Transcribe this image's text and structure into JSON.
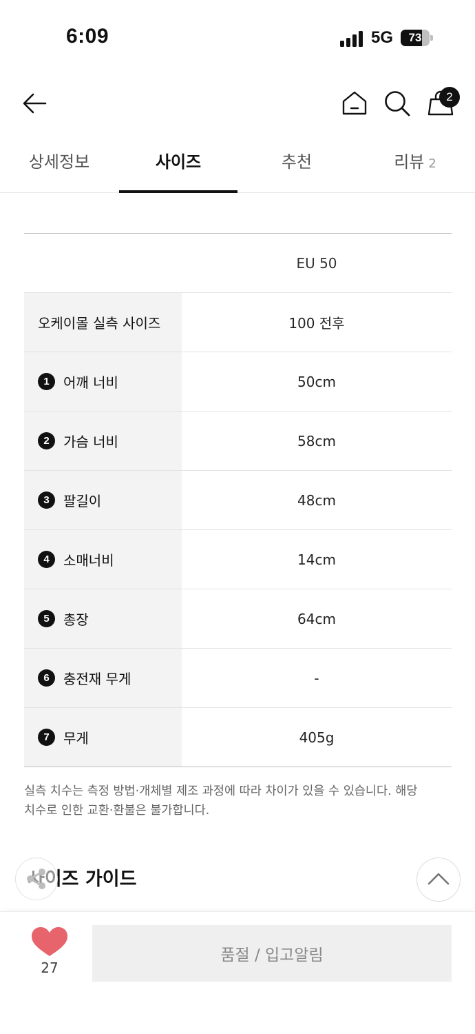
{
  "status_bar": {
    "time": "6:09",
    "network": "5G",
    "battery": "73",
    "battery_level": 0.73
  },
  "header": {
    "back_icon": "arrow-left-icon",
    "home_icon": "home-icon",
    "search_icon": "search-icon",
    "cart_icon": "shopping-bag-icon",
    "cart_badge": "2"
  },
  "tabs": [
    {
      "label": "상세정보",
      "count": ""
    },
    {
      "label": "사이즈",
      "count": ""
    },
    {
      "label": "추천",
      "count": ""
    },
    {
      "label": "리뷰",
      "count": "2"
    }
  ],
  "active_tab": "사이즈",
  "size_table": {
    "column_header": "EU 50",
    "rows": [
      {
        "label": "오케이몰 실측 사이즈",
        "num": "",
        "value": "100 전후"
      },
      {
        "label": "어깨 너비",
        "num": "1",
        "value": "50cm"
      },
      {
        "label": "가슴 너비",
        "num": "2",
        "value": "58cm"
      },
      {
        "label": "팔길이",
        "num": "3",
        "value": "48cm"
      },
      {
        "label": "소매너비",
        "num": "4",
        "value": "14cm"
      },
      {
        "label": "총장",
        "num": "5",
        "value": "64cm"
      },
      {
        "label": "충전재 무게",
        "num": "6",
        "value": "-"
      },
      {
        "label": "무게",
        "num": "7",
        "value": "405g"
      }
    ]
  },
  "notice_line1": "실측 치수는 측정 방법·개체별 제조 과정에 따라 차이가 있을 수 있습니다. 해당",
  "notice_line2": "치수로 인한 교환·환불은 불가합니다.",
  "size_guide_title": "사이즈 가이드",
  "bottom_bar": {
    "like_count": "27",
    "like_color": "#e8646c",
    "action_label": "품절 / 입고알림"
  }
}
